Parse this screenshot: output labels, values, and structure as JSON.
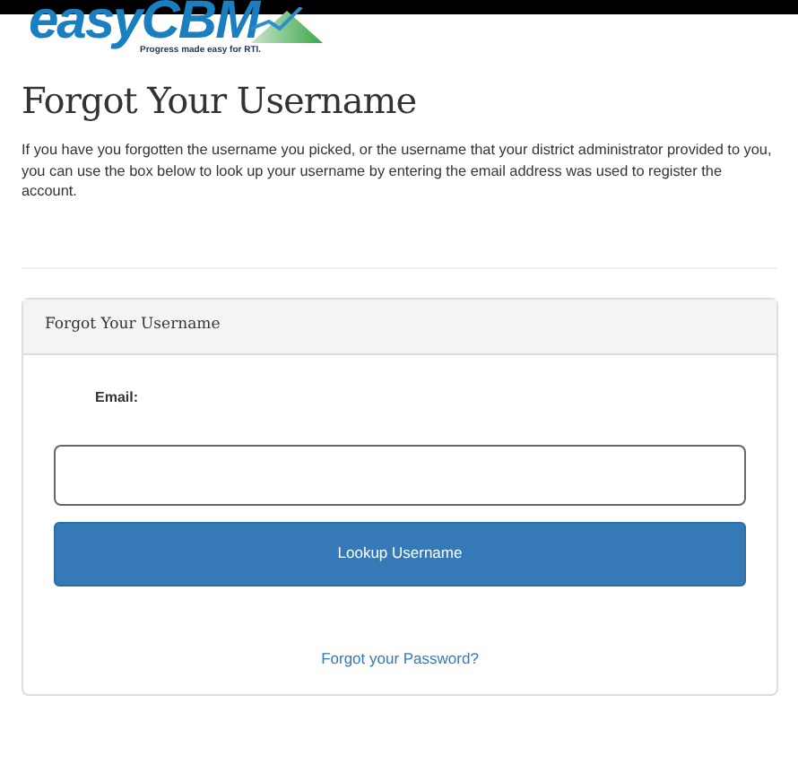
{
  "logo": {
    "name": "easyCBM",
    "tagline": "Progress made easy for RTI."
  },
  "heading": "Forgot Your Username",
  "intro": "If you have you forgotten the username you picked, or the username that your district administrator provided to you, you can use the box below to look up your username by entering the email address was used to register the account.",
  "panel": {
    "title": "Forgot Your Username",
    "email_label": "Email:",
    "button": "Lookup Username",
    "link": "Forgot your Password?"
  }
}
